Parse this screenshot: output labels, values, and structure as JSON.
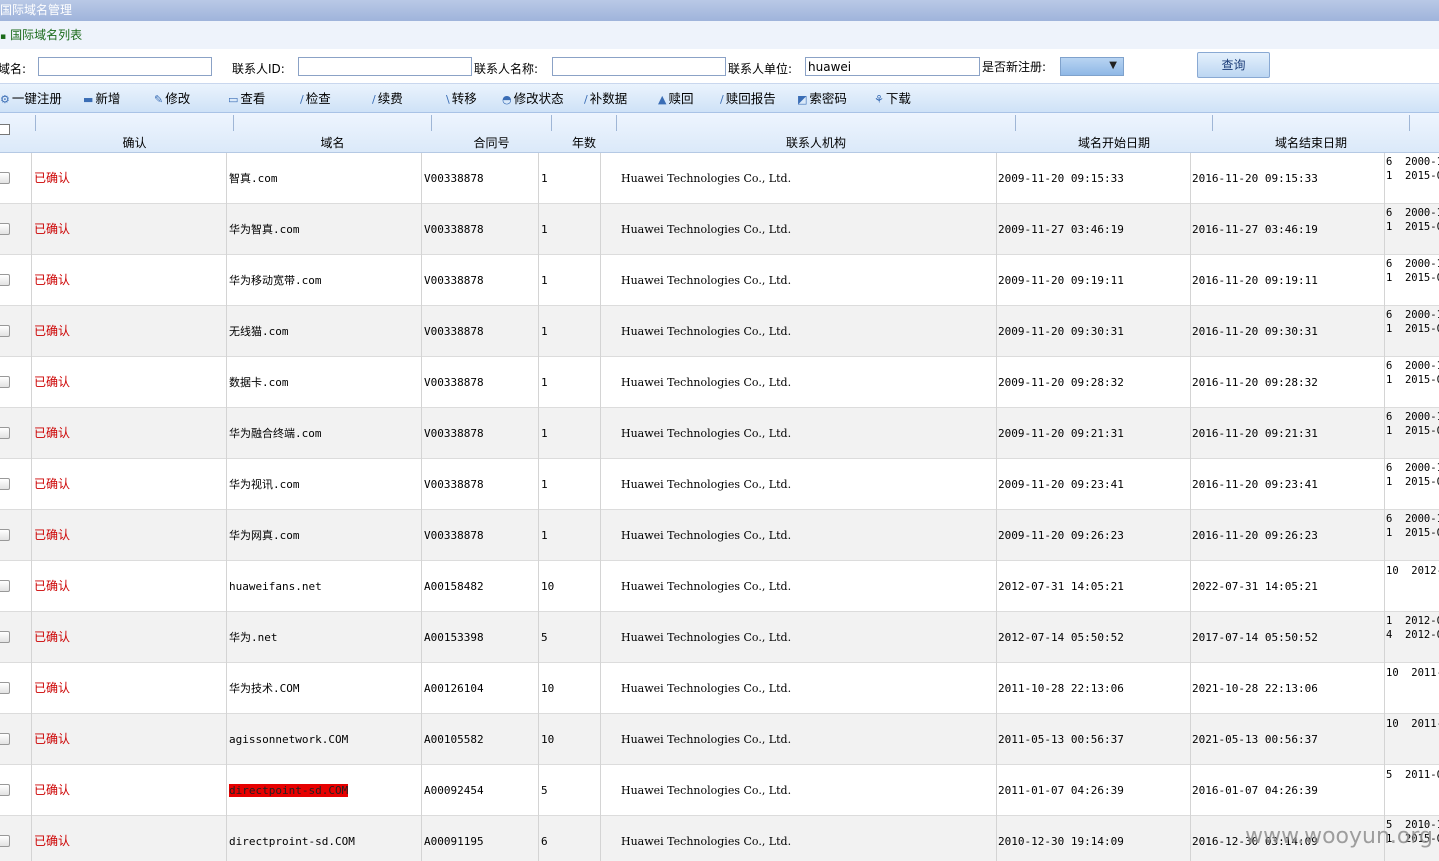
{
  "window": {
    "title": "国际域名管理"
  },
  "subtitle": "国际域名列表",
  "search": {
    "domain_label": "域名:",
    "domain_value": "",
    "contact_id_label": "联系人ID:",
    "contact_id_value": "",
    "contact_name_label": "联系人名称:",
    "contact_name_value": "",
    "contact_org_label": "联系人单位:",
    "contact_org_value": "huawei",
    "is_new_label": "是否新注册:",
    "is_new_value": "",
    "query_label": "查询"
  },
  "toolbar": {
    "items": [
      {
        "label": "一键注册",
        "icon": "register-icon"
      },
      {
        "label": "新增",
        "icon": "add-icon"
      },
      {
        "label": "修改",
        "icon": "edit-icon"
      },
      {
        "label": "查看",
        "icon": "view-icon"
      },
      {
        "label": "检查",
        "icon": "check-icon"
      },
      {
        "label": "续费",
        "icon": "renew-icon"
      },
      {
        "label": "转移",
        "icon": "transfer-icon"
      },
      {
        "label": "修改状态",
        "icon": "status-icon"
      },
      {
        "label": "补数据",
        "icon": "patch-icon"
      },
      {
        "label": "赎回",
        "icon": "redeem-icon"
      },
      {
        "label": "赎回报告",
        "icon": "report-icon"
      },
      {
        "label": "索密码",
        "icon": "password-icon"
      },
      {
        "label": "下载",
        "icon": "download-icon"
      }
    ]
  },
  "table": {
    "columns": [
      "确认",
      "域名",
      "合同号",
      "年数",
      "联系人机构",
      "域名开始日期",
      "域名结束日期"
    ],
    "rows": [
      {
        "status": "已确认",
        "domain": "智真.com",
        "contract": "V00338878",
        "years": "1",
        "org": "Huawei Technologies Co., Ltd.",
        "start": "2009-11-20 09:15:33",
        "end": "2016-11-20 09:15:33",
        "extra": "6  2000-1\n1  2015-0"
      },
      {
        "status": "已确认",
        "domain": "华为智真.com",
        "contract": "V00338878",
        "years": "1",
        "org": "Huawei Technologies Co., Ltd.",
        "start": "2009-11-27 03:46:19",
        "end": "2016-11-27 03:46:19",
        "extra": "6  2000-1\n1  2015-0"
      },
      {
        "status": "已确认",
        "domain": "华为移动宽带.com",
        "contract": "V00338878",
        "years": "1",
        "org": "Huawei Technologies Co., Ltd.",
        "start": "2009-11-20 09:19:11",
        "end": "2016-11-20 09:19:11",
        "extra": "6  2000-1\n1  2015-0"
      },
      {
        "status": "已确认",
        "domain": "无线猫.com",
        "contract": "V00338878",
        "years": "1",
        "org": "Huawei Technologies Co., Ltd.",
        "start": "2009-11-20 09:30:31",
        "end": "2016-11-20 09:30:31",
        "extra": "6  2000-1\n1  2015-0"
      },
      {
        "status": "已确认",
        "domain": "数据卡.com",
        "contract": "V00338878",
        "years": "1",
        "org": "Huawei Technologies Co., Ltd.",
        "start": "2009-11-20 09:28:32",
        "end": "2016-11-20 09:28:32",
        "extra": "6  2000-1\n1  2015-0"
      },
      {
        "status": "已确认",
        "domain": "华为融合终端.com",
        "contract": "V00338878",
        "years": "1",
        "org": "Huawei Technologies Co., Ltd.",
        "start": "2009-11-20 09:21:31",
        "end": "2016-11-20 09:21:31",
        "extra": "6  2000-1\n1  2015-0"
      },
      {
        "status": "已确认",
        "domain": "华为视讯.com",
        "contract": "V00338878",
        "years": "1",
        "org": "Huawei Technologies Co., Ltd.",
        "start": "2009-11-20 09:23:41",
        "end": "2016-11-20 09:23:41",
        "extra": "6  2000-1\n1  2015-0"
      },
      {
        "status": "已确认",
        "domain": "华为网真.com",
        "contract": "V00338878",
        "years": "1",
        "org": "Huawei Technologies Co., Ltd.",
        "start": "2009-11-20 09:26:23",
        "end": "2016-11-20 09:26:23",
        "extra": "6  2000-1\n1  2015-0"
      },
      {
        "status": "已确认",
        "domain": "huaweifans.net",
        "contract": "A00158482",
        "years": "10",
        "org": "Huawei Technologies Co., Ltd.",
        "start": "2012-07-31 14:05:21",
        "end": "2022-07-31 14:05:21",
        "extra": "10  2012-"
      },
      {
        "status": "已确认",
        "domain": "华为.net",
        "contract": "A00153398",
        "years": "5",
        "org": "Huawei Technologies Co., Ltd.",
        "start": "2012-07-14 05:50:52",
        "end": "2017-07-14 05:50:52",
        "extra": "1  2012-0\n4  2012-0"
      },
      {
        "status": "已确认",
        "domain": "华为技术.COM",
        "contract": "A00126104",
        "years": "10",
        "org": "Huawei Technologies Co., Ltd.",
        "start": "2011-10-28 22:13:06",
        "end": "2021-10-28 22:13:06",
        "extra": "10  2011-"
      },
      {
        "status": "已确认",
        "domain": "agissonnetwork.COM",
        "contract": "A00105582",
        "years": "10",
        "org": "Huawei Technologies Co., Ltd.",
        "start": "2011-05-13 00:56:37",
        "end": "2021-05-13 00:56:37",
        "extra": "10  2011-"
      },
      {
        "status": "已确认",
        "domain": "directpoint-sd.COM",
        "contract": "A00092454",
        "years": "5",
        "org": "Huawei Technologies Co., Ltd.",
        "start": "2011-01-07 04:26:39",
        "end": "2016-01-07 04:26:39",
        "extra": "5  2011-0",
        "highlight": true
      },
      {
        "status": "已确认",
        "domain": "directproint-sd.COM",
        "contract": "A00091195",
        "years": "6",
        "org": "Huawei Technologies Co., Ltd.",
        "start": "2010-12-30 19:14:09",
        "end": "2016-12-30 03:14:09",
        "extra": "5  2010-1\n1  2015-0"
      }
    ]
  },
  "watermark": "www.wooyun.org"
}
